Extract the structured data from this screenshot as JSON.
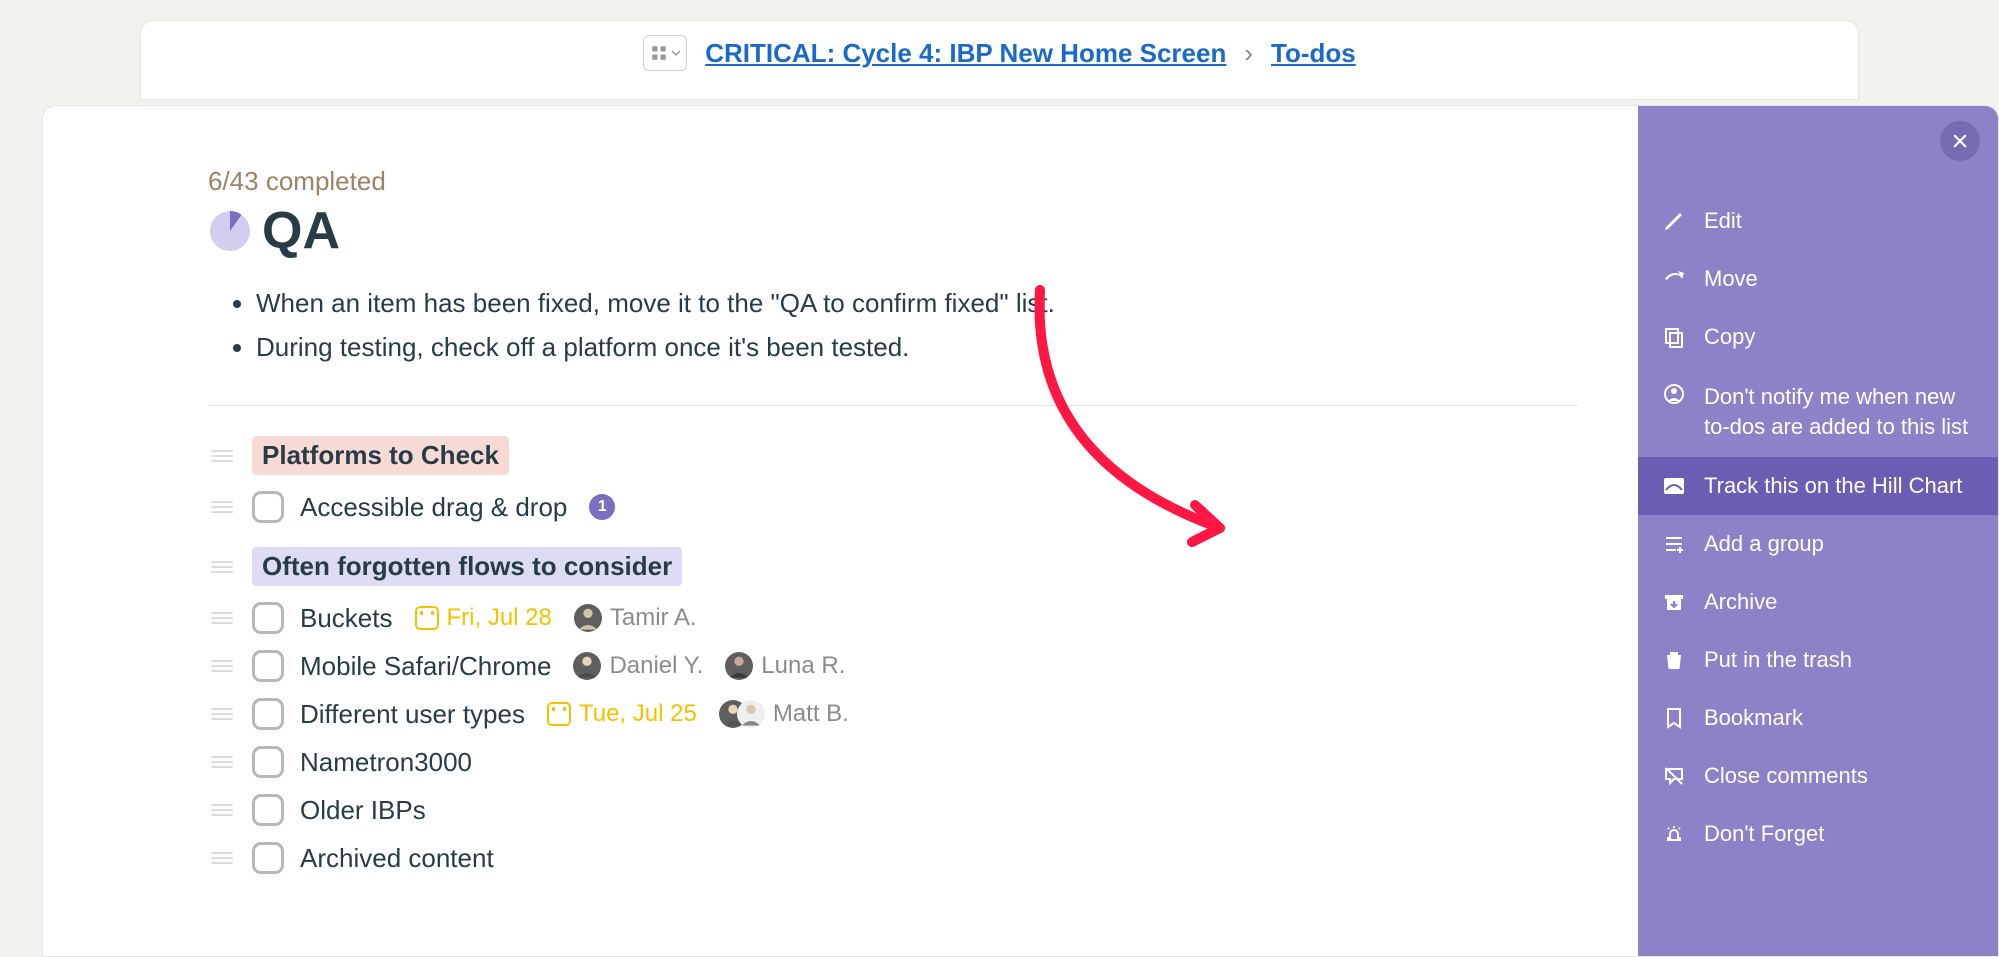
{
  "breadcrumb": {
    "project": "CRITICAL: Cycle 4: IBP New Home Screen",
    "separator": "›",
    "section": "To-dos"
  },
  "header": {
    "completed_text": "6/43 completed",
    "title": "QA",
    "description": [
      "When an item has been fixed, move it to the \"QA to confirm fixed\" list.",
      "During testing, check off a platform once it's been tested."
    ]
  },
  "groups": [
    {
      "label": "Platforms to Check",
      "color": "pink"
    },
    {
      "label": "Often forgotten flows to consider",
      "color": "lavender"
    }
  ],
  "todos": {
    "accessible_drag_drop": {
      "title": "Accessible drag & drop",
      "badge": "1"
    },
    "buckets": {
      "title": "Buckets",
      "date": "Fri, Jul 28",
      "assignee": "Tamir A."
    },
    "mobile_safari_chrome": {
      "title": "Mobile Safari/Chrome",
      "assignee1": "Daniel Y.",
      "assignee2": "Luna R."
    },
    "different_user_types": {
      "title": "Different user types",
      "date": "Tue, Jul 25",
      "assignee": "Matt B."
    },
    "nametron": {
      "title": "Nametron3000"
    },
    "older_ibps": {
      "title": "Older IBPs"
    },
    "archived_content": {
      "title": "Archived content"
    }
  },
  "panel": {
    "edit": "Edit",
    "move": "Move",
    "copy": "Copy",
    "notify": "Don't notify me when new to-dos are added to this list",
    "track_hill": "Track this on the Hill Chart",
    "add_group": "Add a group",
    "archive": "Archive",
    "trash": "Put in the trash",
    "bookmark": "Bookmark",
    "close_comments": "Close comments",
    "dont_forget": "Don't Forget"
  }
}
